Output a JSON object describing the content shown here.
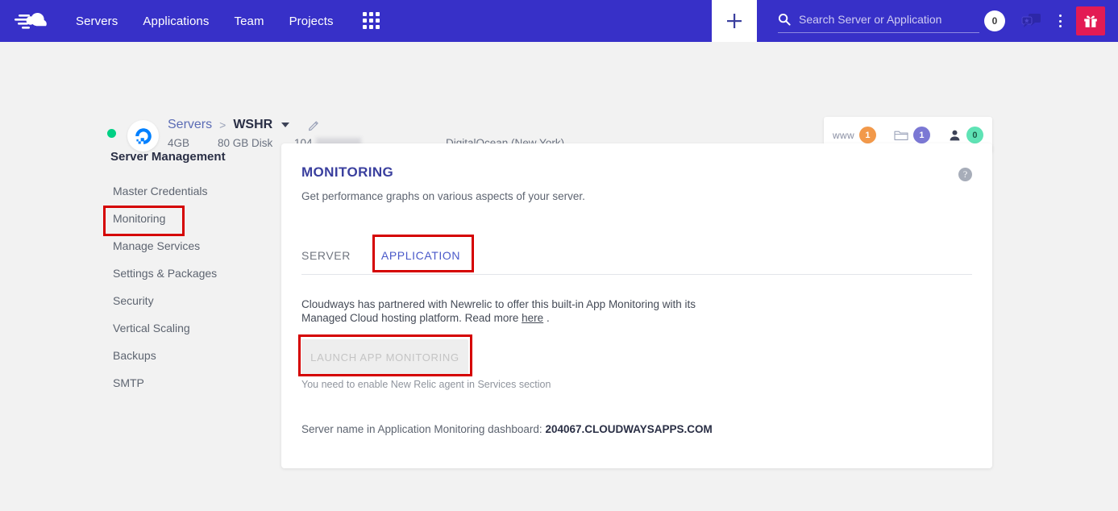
{
  "topnav": {
    "logo_name": "cloudways-logo",
    "links": [
      {
        "label": "Servers"
      },
      {
        "label": "Applications"
      },
      {
        "label": "Team"
      },
      {
        "label": "Projects"
      }
    ],
    "grid_icon": "apps-grid-icon",
    "add_icon": "plus-icon",
    "search": {
      "placeholder": "Search Server or Application",
      "value": "",
      "icon": "search-icon",
      "badge": "0"
    },
    "chat_icon": "chat-support-icon",
    "menu_icon": "kebab-menu-icon",
    "gift_icon": "gift-icon",
    "colors": {
      "bar": "#3730c8",
      "gift": "#e31b54"
    }
  },
  "server_bar": {
    "status": "online",
    "provider_icon": "digitalocean-logo",
    "breadcrumb": {
      "parent": "Servers",
      "separator": ">",
      "current": "WSHR",
      "caret": "chevron-down-icon",
      "edit_icon": "pencil-edit-icon"
    },
    "meta": {
      "ram": "4GB",
      "disk": "80 GB Disk",
      "ip": "104.",
      "provider": "DigitalOcean (New York)"
    },
    "stats": [
      {
        "label": "www",
        "value": "1",
        "icon": "www-label",
        "color": "#f2994a"
      },
      {
        "label": "",
        "value": "1",
        "icon": "folder-icon",
        "color": "#7b78d4"
      },
      {
        "label": "",
        "value": "0",
        "icon": "user-icon",
        "color": "#5fe3b5"
      }
    ]
  },
  "sidebar": {
    "title": "Server Management",
    "items": [
      {
        "label": "Master Credentials"
      },
      {
        "label": "Monitoring"
      },
      {
        "label": "Manage Services"
      },
      {
        "label": "Settings & Packages"
      },
      {
        "label": "Security"
      },
      {
        "label": "Vertical Scaling"
      },
      {
        "label": "Backups"
      },
      {
        "label": "SMTP"
      }
    ]
  },
  "card": {
    "title": "MONITORING",
    "subtitle": "Get performance graphs on various aspects of your server.",
    "help_icon": "help-question-icon",
    "help_glyph": "?",
    "tabs": [
      {
        "label": "SERVER",
        "active": false
      },
      {
        "label": "APPLICATION",
        "active": true
      }
    ],
    "description": {
      "before_link": "Cloudways has partnered with Newrelic to offer this built-in App Monitoring with its Managed Cloud hosting platform. Read more ",
      "link": "here",
      "after_link": " ."
    },
    "launch_button": {
      "label": "LAUNCH APP MONITORING",
      "disabled": true
    },
    "hint": "You need to enable New Relic agent in Services section",
    "server_name": {
      "label": "Server name in Application Monitoring dashboard: ",
      "value": "204067.CLOUDWAYSAPPS.COM"
    }
  },
  "annotations": {
    "color": "#d50000",
    "boxes": [
      {
        "target": "sidebar-item-monitoring"
      },
      {
        "target": "tab-application"
      },
      {
        "target": "launch-app-monitoring-button"
      }
    ]
  }
}
